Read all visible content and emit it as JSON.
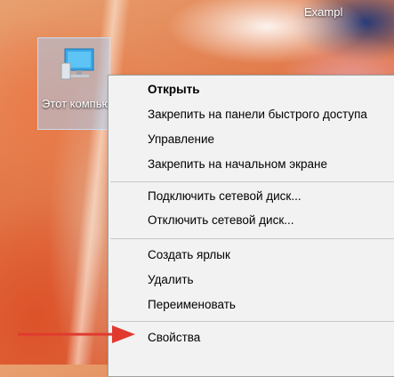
{
  "desktop": {
    "top_icon_label": "Exampl",
    "this_pc_label": "Этот компьютер"
  },
  "context_menu": {
    "items": [
      {
        "label": "Открыть",
        "bold": true
      },
      {
        "label": "Закрепить на панели быстрого доступа"
      },
      {
        "label": "Управление"
      },
      {
        "label": "Закрепить на начальном экране"
      },
      {
        "label": "Подключить сетевой диск..."
      },
      {
        "label": "Отключить сетевой диск..."
      },
      {
        "label": "Создать ярлык"
      },
      {
        "label": "Удалить"
      },
      {
        "label": "Переименовать"
      },
      {
        "label": "Свойства"
      }
    ]
  },
  "colors": {
    "arrow": "#e03a2f",
    "menu_background": "#f2f2f2",
    "selection": "#cce8ff"
  },
  "icons": [
    "computer-icon",
    "red-arrow-annotation"
  ]
}
